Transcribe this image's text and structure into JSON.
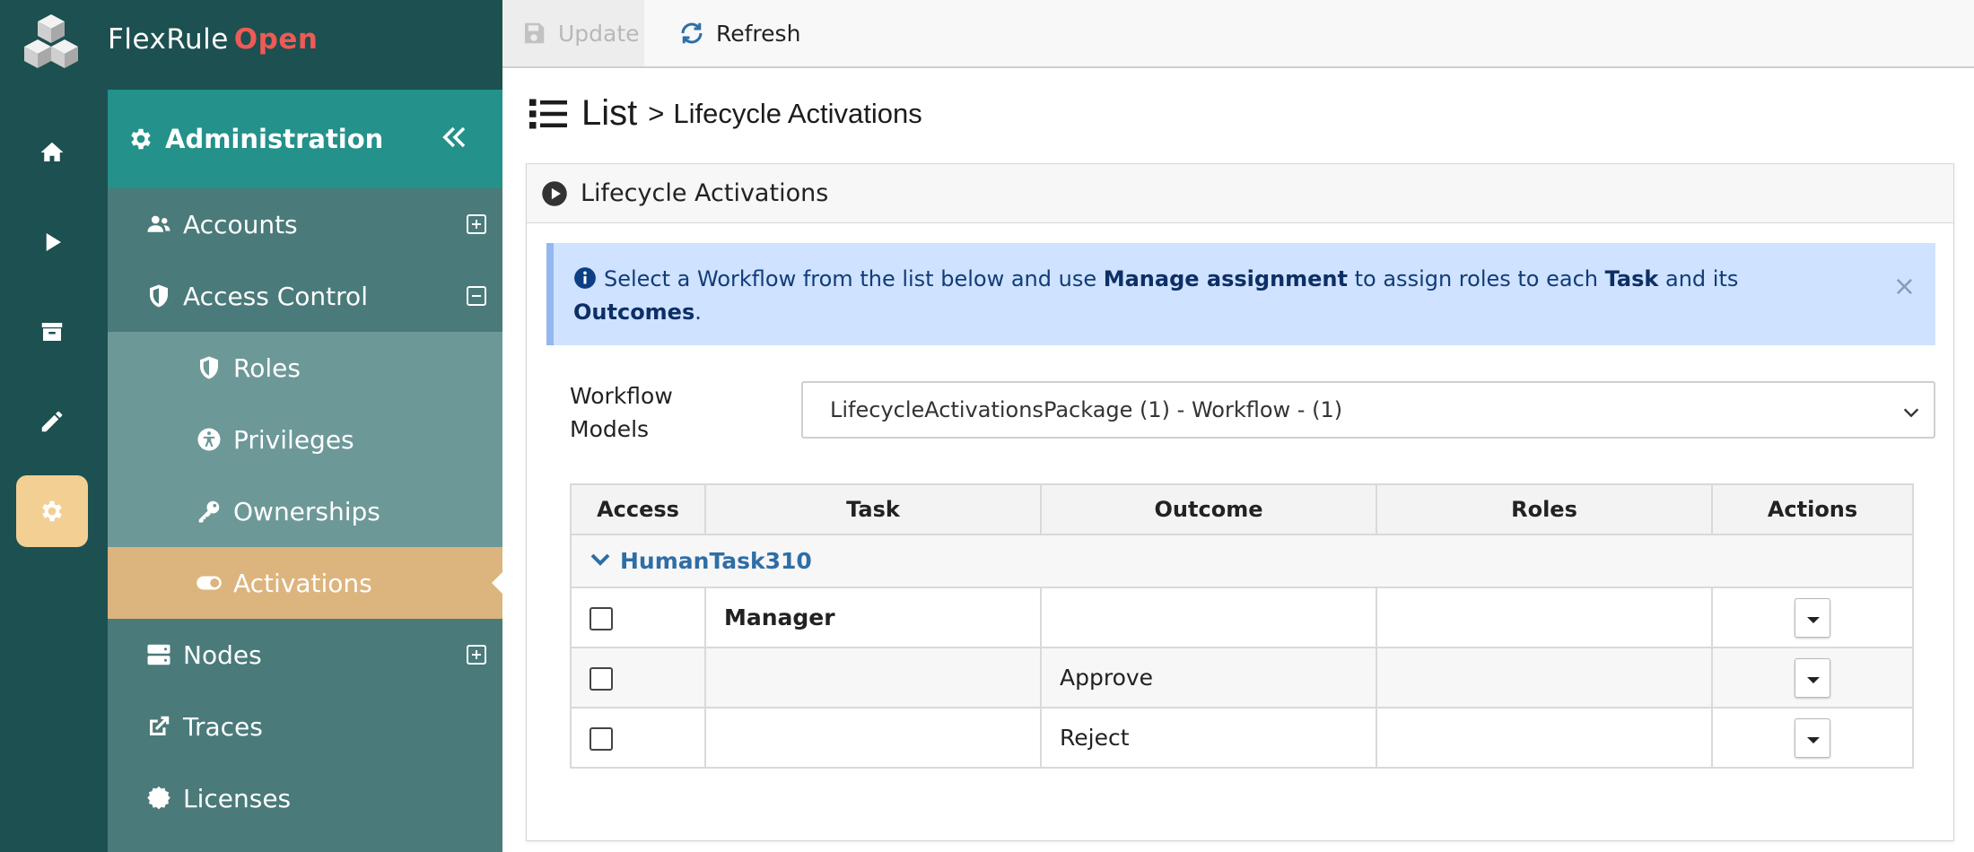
{
  "brand": {
    "name": "FlexRule",
    "suffix": "Open"
  },
  "rail": {
    "items": [
      {
        "icon": "home-icon"
      },
      {
        "icon": "play-icon"
      },
      {
        "icon": "archive-icon"
      },
      {
        "icon": "pencil-icon"
      },
      {
        "icon": "gear-icon",
        "active": true
      }
    ]
  },
  "sidebar": {
    "header": "Administration",
    "items": [
      {
        "label": "Accounts",
        "icon": "users-icon",
        "toggle": "expand"
      },
      {
        "label": "Access Control",
        "icon": "shield-icon",
        "toggle": "collapse"
      },
      {
        "label": "Roles",
        "icon": "shield-half-icon"
      },
      {
        "label": "Privileges",
        "icon": "accessibility-icon"
      },
      {
        "label": "Ownerships",
        "icon": "key-icon"
      },
      {
        "label": "Activations",
        "icon": "toggle-icon",
        "active": true
      },
      {
        "label": "Nodes",
        "icon": "server-icon",
        "toggle": "expand"
      },
      {
        "label": "Traces",
        "icon": "external-link-icon"
      },
      {
        "label": "Licenses",
        "icon": "certificate-icon"
      }
    ]
  },
  "toolbar": {
    "update_label": "Update",
    "refresh_label": "Refresh"
  },
  "page": {
    "list_label": "List",
    "separator": ">",
    "crumb": "Lifecycle Activations"
  },
  "panel": {
    "title": "Lifecycle Activations",
    "alert": {
      "t1": "Select a Workflow from the list below and use ",
      "b1": "Manage assignment",
      "t2": " to assign roles to each ",
      "b2": "Task",
      "t3": " and its ",
      "b3": "Outcomes",
      "t4": ".",
      "close": "×"
    },
    "workflow": {
      "label_line1": "Workflow",
      "label_line2": "Models",
      "selected": "LifecycleActivationsPackage (1) - Workflow - (1)"
    },
    "table": {
      "headers": [
        "Access",
        "Task",
        "Outcome",
        "Roles",
        "Actions"
      ],
      "group": "HumanTask310",
      "rows": [
        {
          "task": "Manager",
          "outcome": "",
          "roles": ""
        },
        {
          "task": "",
          "outcome": "Approve",
          "roles": ""
        },
        {
          "task": "",
          "outcome": "Reject",
          "roles": ""
        }
      ]
    }
  },
  "colors": {
    "rail": "#1d5050",
    "accent": "#24918a",
    "active": "#dcb47e",
    "brand_open": "#ee5a55"
  }
}
